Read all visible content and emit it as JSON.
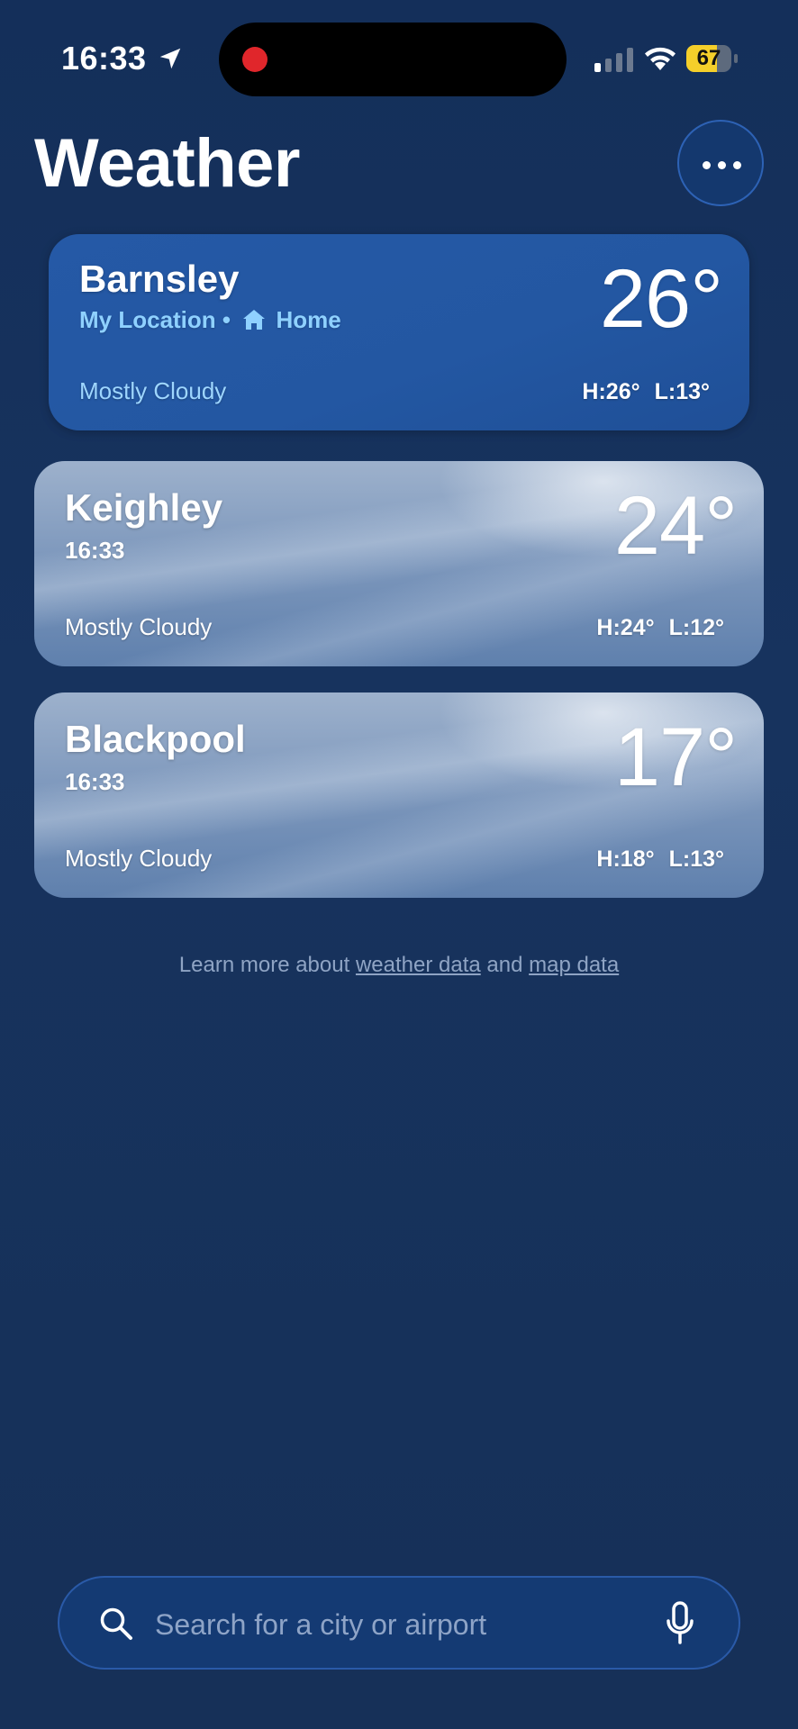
{
  "status_bar": {
    "time": "16:33",
    "battery": "67",
    "battery_level": 0.67,
    "icons": [
      "location-arrow-icon",
      "recording-dot-icon",
      "cellular-signal-icon",
      "wifi-icon",
      "battery-icon"
    ]
  },
  "header": {
    "title": "Weather",
    "more_icon": "ellipsis-icon"
  },
  "locations": [
    {
      "city": "Barnsley",
      "subtitle_prefix": "My Location •",
      "subtitle_suffix": "Home",
      "temperature": "26°",
      "condition": "Mostly Cloudy",
      "high": "H:26°",
      "low": "L:13°"
    },
    {
      "city": "Keighley",
      "local_time": "16:33",
      "temperature": "24°",
      "condition": "Mostly Cloudy",
      "high": "H:24°",
      "low": "L:12°"
    },
    {
      "city": "Blackpool",
      "local_time": "16:33",
      "temperature": "17°",
      "condition": "Mostly Cloudy",
      "high": "H:18°",
      "low": "L:13°"
    }
  ],
  "footer_note": {
    "prefix": "Learn more about",
    "weather_link": "weather data",
    "joiner": "and",
    "map_link": "map data"
  },
  "search": {
    "placeholder": "Search for a city or airport",
    "value": ""
  },
  "colors": {
    "background": "#142f5a",
    "primary_card": "#2357a2",
    "accent_text": "#8fd1ff",
    "recording_dot": "#e0262b",
    "battery_fill": "#f5cf2a"
  }
}
